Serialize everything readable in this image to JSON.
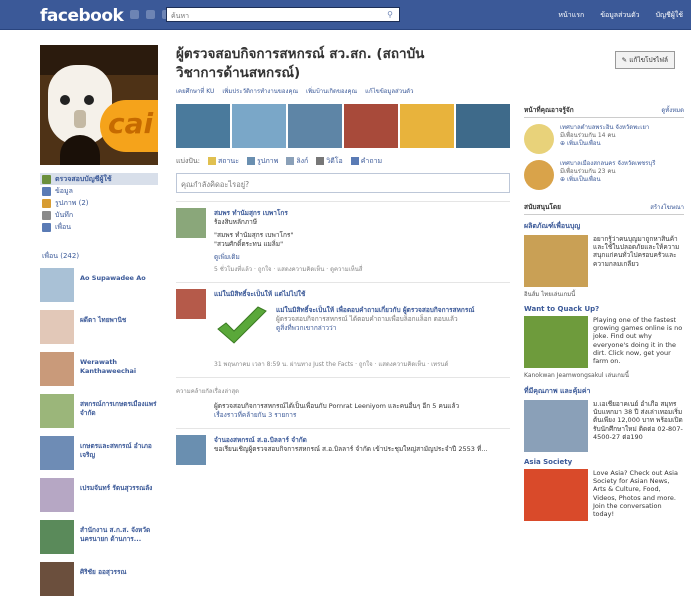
{
  "topbar": {
    "logo": "facebook",
    "search_placeholder": "ค้นหา",
    "links": [
      "หน้าแรก",
      "ข้อมูลส่วนตัว",
      "บัญชีผู้ใช้"
    ]
  },
  "left": {
    "nav": [
      {
        "label": "ตรวจสอบบัญชีผู้ใช้",
        "sel": true,
        "color": "#6a8f3c"
      },
      {
        "label": "ข้อมูล",
        "color": "#5a7bb5"
      },
      {
        "label": "รูปภาพ (2)",
        "color": "#d79c32"
      },
      {
        "label": "บันทึก",
        "color": "#8a8a8a"
      },
      {
        "label": "เพื่อน",
        "color": "#5a7bb5"
      }
    ],
    "friends_header": "เพื่อน (242)",
    "friends": [
      {
        "name": "Ao Supawadee Ao",
        "color": "#a9c1d6"
      },
      {
        "name": "ผดีตา ไทยพานิช",
        "color": "#e2c8b8"
      },
      {
        "name": "Werawath Kanthaweechai",
        "color": "#c99a7a"
      },
      {
        "name": "สหกรณ์การเกษตรเมืองแพร่ จำกัด",
        "color": "#9bb67a"
      },
      {
        "name": "เกษตรและสหกรณ์ อำเภอเจริญ",
        "color": "#6e8cb5"
      },
      {
        "name": "เปรมจันทร์ รัตนสุวรรณลัง",
        "color": "#b6a7c4"
      },
      {
        "name": "สำนักงาน ส.ก.ส. จังหวัดนครนายก ด้านการ...",
        "color": "#5a8a5a"
      },
      {
        "name": "ศิริชัย ออสุวรรณ",
        "color": "#6b4f3d"
      }
    ]
  },
  "main": {
    "title": "ผู้ตรวจสอบกิจการสหกรณ์ สว.สก. (สถาบันวิชาการด้านสหกรณ์)",
    "edit_label": "แก้ไขโปรไฟล์",
    "info": [
      "เคยศึกษาที่ KU",
      "เพิ่มประวัติการทำงานของคุณ",
      "เพิ่มบ้านเกิดของคุณ",
      "แก้ไขข้อมูลส่วนตัว"
    ],
    "share_label": "แบ่งปัน:",
    "share_items": [
      "สถานะ",
      "รูปภาพ",
      "ลิงก์",
      "วิดีโอ",
      "คำถาม"
    ],
    "status_placeholder": "คุณกำลังคิดอะไรอยู่?",
    "story1": {
      "name": "สมพร ทำนัมสุกร เบพาโกร",
      "line1": "ร้องสิบหลักภาษี",
      "line2": "\"สมพร ทำนัมสุกร เบพาโกร\"",
      "line3": "\"สวนศักดิ์ตระทน แมลิ่ม\"",
      "link": "ดูเพิ่มเติม",
      "meta": "5 ชั่วโมงที่แล้ว · ถูกใจ · แสดงความคิดเห็น · ดูความเห็นสี่"
    },
    "story2": {
      "title": "แม่ในมิสิทธิ์จะเป็นให้ แต่ไม่ไปใช้",
      "heading": "แม่ในมิสิทธิ์จะเป็นให้ เพื่อตอบคำถามเกี่ยวกับ ผู้ตรวจสอบกิจการสหกรณ์",
      "body": "ผู้ตรวจสอบกิจการสหกรณ์ ได้ตอบคำถามเพื่อบล็อกแล็อก ตอบแล้ว",
      "link": "ดูสิ่งที่พวกเขากล่าวว่า",
      "meta": "31 พฤษภาคม เวลา 8:59 น. ผ่านทาง Just the Facts · ถูกใจ · แสดงความคิดเห็น · เทรนด์"
    },
    "divider_label": "ความคล้ายกัลเรื่องล่าสุด",
    "story3": {
      "text": "ผู้ตรวจสอบกิจการสหกรณ์ได้เป็นเพื่อนกับ Pornrat Leeniyom และคนอื่นๆ อีก 5 คนแล้ว",
      "link": "เรื่องราวที่คล้ายกัน 3 รายการ"
    },
    "story4": {
      "name": "จำนองสหกรณ์ ส.อ.บิลลาร์ จำกัด",
      "text": "ขอเรียนเชิญผู้ตรวจสอบกิจการสหกรณ์ ส.อ.บิลลาร์ จำกัด เข้าประชุมใหญ่สามัญประจำปี 2553 ที่..."
    }
  },
  "right": {
    "pages_hd": "หน้าที่คุณอาจรู้จัก",
    "pages_more": "ดูทั้งหมด",
    "pages": [
      {
        "name": "เทศบาลตำบลพระอิน จังหวัดพะเยา",
        "members": "มีเพื่อนร่วมกัน 14 คน",
        "action": "เพิ่มเป็นเพื่อน",
        "color": "#e8d27a"
      },
      {
        "name": "เทศบาลเมืองสกลนคร จังหวัดเพชรบุรี",
        "members": "มีเพื่อนร่วมกัน 23 คน",
        "action": "เพิ่มเป็นเพื่อน",
        "color": "#d9a34a"
      }
    ],
    "sponsored_hd": "สนับสนุนโดย",
    "sponsored_more": "สร้างโฆษณา",
    "ads": [
      {
        "title": "ผลิตภัณฑ์เพื่อนบุญ",
        "text": "อยากรู้ว่าคนบุญมาถูกหาสินค้าและใช้ในปลอดภัยและให้ความสนุกแก่คนทั่วไปครอบครัวและความกลมเกลียว",
        "foot": "อินส์ม ไทยเล่นเกมนี้",
        "color": "#c9a055"
      },
      {
        "title": "Want to Quack Up?",
        "text": "Playing one of the fastest growing games online is no joke. Find out why everyone's doing it in the dirt. Click now, get your farm on.",
        "foot": "Kanokwan Jeamwongsakul เล่นเกมนี้",
        "color": "#6e9b3c"
      },
      {
        "title": "ที่มีคุณภาพ และคุ้มค่า",
        "text": "ม.เอเชียอาคเนย์ อำเภือ สมุทร นับแหกมา 38 ปี ส่งเล่าเทอมเริ่มต้นเพียง 12,000 บาท พร้อมเปิดรับนักศึกษาใหม่ ติดต่อ 02-807-4500-27 ต่อ190",
        "foot": "",
        "color": "#8aa0b8"
      },
      {
        "title": "Asia Society",
        "text": "Love Asia? Check out Asia Society for Asian News, Arts & Culture, Food, Videos, Photos and more. Join the conversation today!",
        "foot": "",
        "color": "#d94a2a"
      }
    ]
  }
}
